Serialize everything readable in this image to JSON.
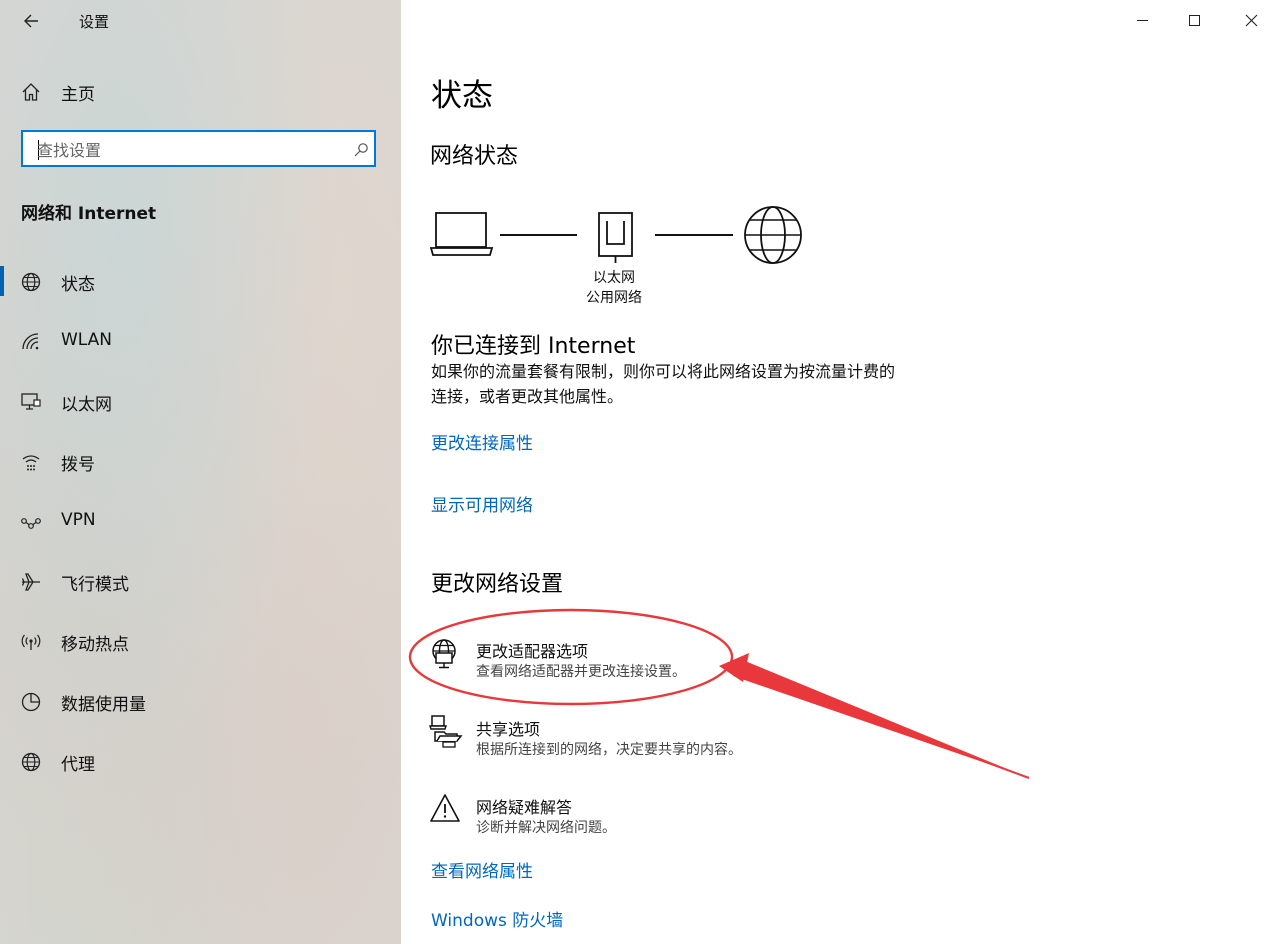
{
  "window": {
    "title": "设置",
    "controls": {
      "minimize": "minimize",
      "maximize": "maximize",
      "close": "close"
    }
  },
  "sidebar": {
    "home_label": "主页",
    "search": {
      "placeholder": "查找设置",
      "value": ""
    },
    "section_title": "网络和 Internet",
    "items": [
      {
        "label": "状态",
        "icon": "globe-icon",
        "selected": true
      },
      {
        "label": "WLAN",
        "icon": "wifi-icon"
      },
      {
        "label": "以太网",
        "icon": "ethernet-icon"
      },
      {
        "label": "拨号",
        "icon": "dialup-icon"
      },
      {
        "label": "VPN",
        "icon": "vpn-icon"
      },
      {
        "label": "飞行模式",
        "icon": "airplane-icon"
      },
      {
        "label": "移动热点",
        "icon": "hotspot-icon"
      },
      {
        "label": "数据使用量",
        "icon": "data-usage-icon"
      },
      {
        "label": "代理",
        "icon": "proxy-globe-icon"
      }
    ],
    "accent_color": "#0063b1"
  },
  "main": {
    "page_title": "状态",
    "network_status_heading": "网络状态",
    "diagram": {
      "adapter_name": "以太网",
      "network_type": "公用网络"
    },
    "connection": {
      "title": "你已连接到 Internet",
      "description_line1": "如果你的流量套餐有限制，则你可以将此网络设置为按流量计费的",
      "description_line2": "连接，或者更改其他属性。"
    },
    "links": {
      "change_connection_properties": "更改连接属性",
      "show_available_networks": "显示可用网络",
      "view_network_properties": "查看网络属性",
      "windows_firewall": "Windows 防火墙"
    },
    "change_settings_heading": "更改网络设置",
    "settings": [
      {
        "title": "更改适配器选项",
        "desc": "查看网络适配器并更改连接设置。",
        "icon": "adapter-icon"
      },
      {
        "title": "共享选项",
        "desc": "根据所连接到的网络，决定要共享的内容。",
        "icon": "sharing-icon"
      },
      {
        "title": "网络疑难解答",
        "desc": "诊断并解决网络问题。",
        "icon": "warning-icon"
      }
    ],
    "link_color": "#0067c0",
    "annotation_color": "#e8383b"
  }
}
